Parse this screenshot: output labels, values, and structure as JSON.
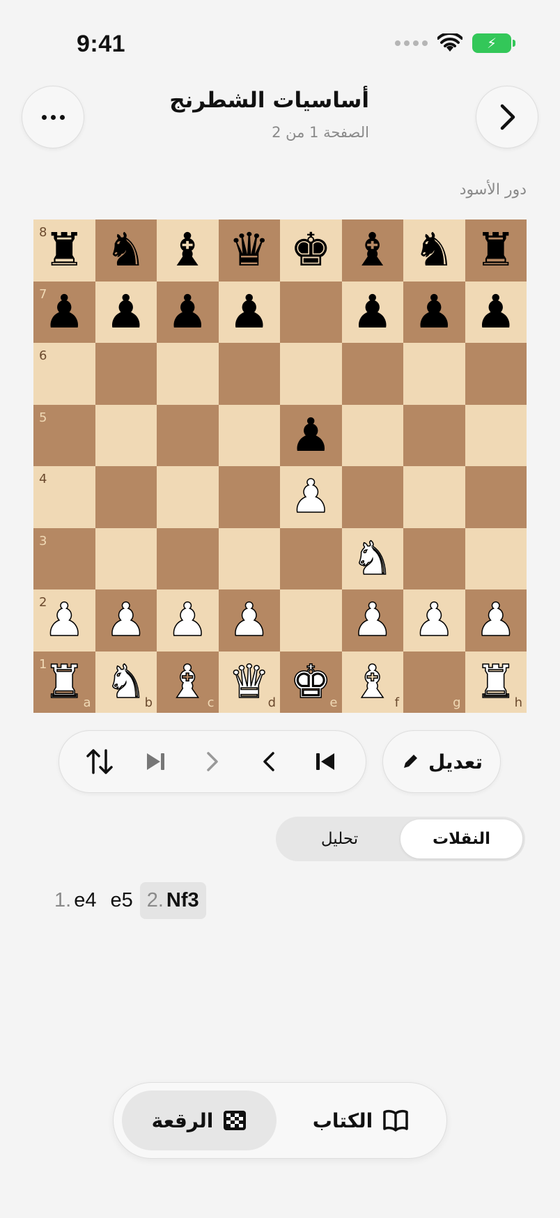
{
  "status_bar": {
    "time": "9:41",
    "battery_icon": "battery-charging-icon",
    "wifi_icon": "wifi-icon"
  },
  "header": {
    "title": "أساسيات الشطرنج",
    "subtitle": "الصفحة 1 من 2",
    "more_icon": "ellipsis-icon",
    "next_icon": "chevron-right-icon"
  },
  "turn_label": "دور الأسود",
  "board": {
    "light_color": "#f0d9b5",
    "dark_color": "#b58863",
    "ranks": [
      "8",
      "7",
      "6",
      "5",
      "4",
      "3",
      "2",
      "1"
    ],
    "files": [
      "a",
      "b",
      "c",
      "d",
      "e",
      "f",
      "g",
      "h"
    ],
    "position": [
      [
        "bR",
        "bN",
        "bB",
        "bQ",
        "bK",
        "bB",
        "bN",
        "bR"
      ],
      [
        "bP",
        "bP",
        "bP",
        "bP",
        "",
        "bP",
        "bP",
        "bP"
      ],
      [
        "",
        "",
        "",
        "",
        "",
        "",
        "",
        ""
      ],
      [
        "",
        "",
        "",
        "",
        "bP",
        "",
        "",
        ""
      ],
      [
        "",
        "",
        "",
        "",
        "wP",
        "",
        "",
        ""
      ],
      [
        "",
        "",
        "",
        "",
        "",
        "wN",
        "",
        ""
      ],
      [
        "wP",
        "wP",
        "wP",
        "wP",
        "",
        "wP",
        "wP",
        "wP"
      ],
      [
        "wR",
        "wN",
        "wB",
        "wQ",
        "wK",
        "wB",
        "",
        "wR"
      ]
    ]
  },
  "controls": {
    "flip_icon": "flip-board-icon",
    "last_icon": "skip-to-end-icon",
    "forward_icon": "chevron-forward-icon",
    "back_icon": "chevron-back-icon",
    "first_icon": "skip-to-start-icon",
    "edit_label": "تعديل",
    "edit_icon": "pencil-icon"
  },
  "segment": {
    "moves_label": "النقلات",
    "analysis_label": "تحليل",
    "selected": "moves"
  },
  "moves": [
    {
      "num": "1.",
      "san": "e4",
      "selected": false
    },
    {
      "num": "",
      "san": "e5",
      "selected": false
    },
    {
      "num": "2.",
      "san": "Nf3",
      "selected": true
    }
  ],
  "tabbar": {
    "board_label": "الرقعة",
    "board_icon": "checkerboard-icon",
    "book_label": "الكتاب",
    "book_icon": "book-icon",
    "active": "board"
  }
}
